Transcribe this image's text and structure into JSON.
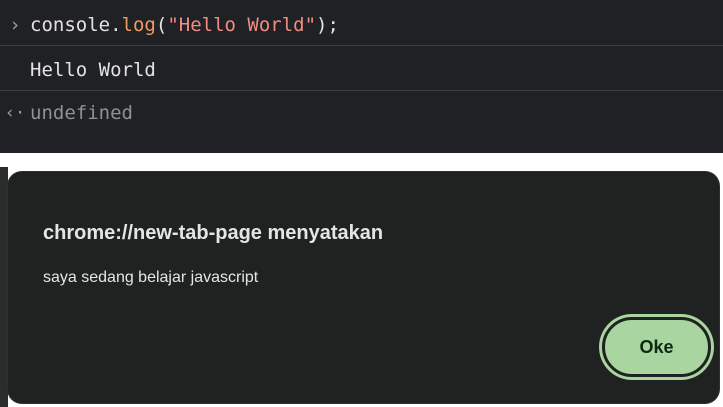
{
  "console": {
    "input_prompt": "›",
    "input_code": {
      "object": "console",
      "dot": ".",
      "method": "log",
      "open": "(",
      "string": "\"Hello World\"",
      "close": ");"
    },
    "output_text": "Hello World",
    "result_prompt": "‹·",
    "result_text": "undefined"
  },
  "dialog": {
    "title": "chrome://new-tab-page menyatakan",
    "message": "saya sedang belajar javascript",
    "ok_label": "Oke"
  },
  "colors": {
    "console_bg": "#202124",
    "dialog_bg": "#1f2220",
    "ok_button": "#a8d5a0",
    "string_token": "#f28b82",
    "method_token": "#f29766"
  }
}
